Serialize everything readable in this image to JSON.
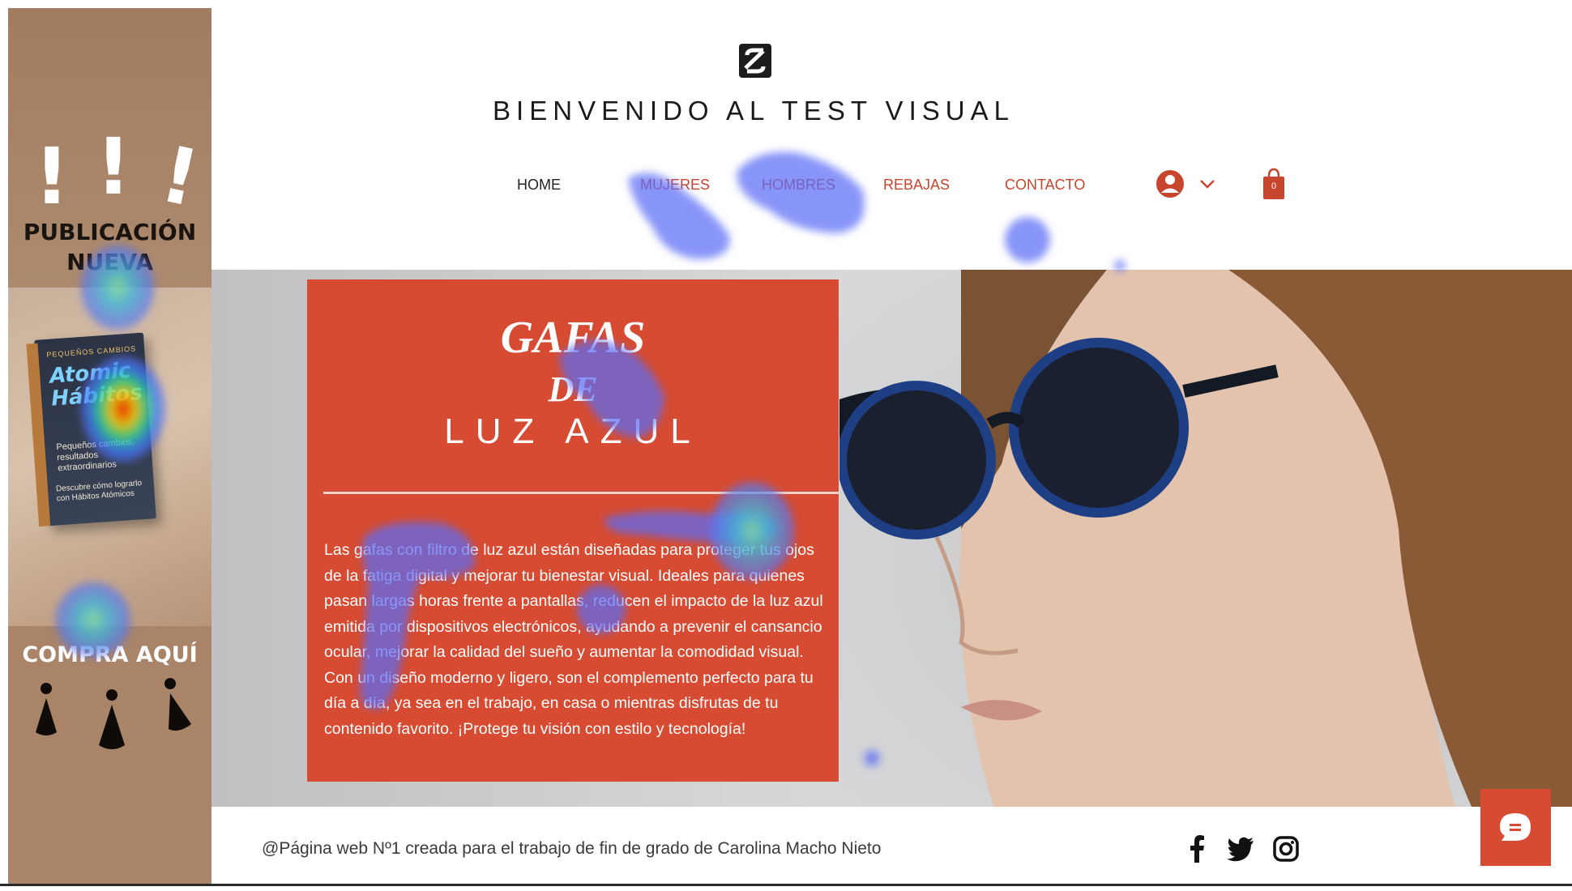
{
  "ad": {
    "exclamations": "!",
    "title_line1": "PUBLICACIÓN",
    "title_line2": "NUEVA",
    "book_small": "PEQUEÑOS CAMBIOS",
    "book_title": "Atomic Hábitos",
    "book_sub": "Pequeños cambios, resultados extraordinarios",
    "book_sub2": "Descubre cómo lograrlo con Hábitos Atómicos",
    "cta": "COMPRA AQUÍ"
  },
  "header": {
    "title": "BIENVENIDO AL TEST VISUAL",
    "nav": [
      "HOME",
      "MUJERES",
      "HOMBRES",
      "REBAJAS",
      "CONTACTO"
    ],
    "cart_count": "0"
  },
  "hero": {
    "heading_1": "GAFAS",
    "heading_2": "DE",
    "heading_3": "LUZ AZUL",
    "body": "Las gafas con filtro de luz azul están diseñadas para proteger tus ojos de la fatiga digital y mejorar tu bienestar visual. Ideales para quienes pasan largas horas frente a pantallas, reducen el impacto de la luz azul emitida por dispositivos electrónicos, ayudando a prevenir el cansancio ocular, mejorar la calidad del sueño y aumentar la comodidad visual. Con un diseño moderno y ligero, son el complemento perfecto para tu día a día, ya sea en el trabajo, en casa o mientras disfrutas de tu contenido favorito. ¡Protege tu visión con estilo y tecnología!"
  },
  "footer": {
    "text": "@Página web Nº1 creada para el trabajo de fin de grado de Carolina Macho Nieto"
  },
  "icons": {
    "logo": "s-logo-icon",
    "account": "user-icon",
    "cart": "shopping-bag-icon",
    "social": [
      "facebook-icon",
      "twitter-icon",
      "instagram-icon"
    ],
    "chat": "chat-icon"
  },
  "colors": {
    "accent": "#d64b31",
    "heat_cool": "#5b6cf5",
    "heat_warm": "#ff2a00"
  }
}
